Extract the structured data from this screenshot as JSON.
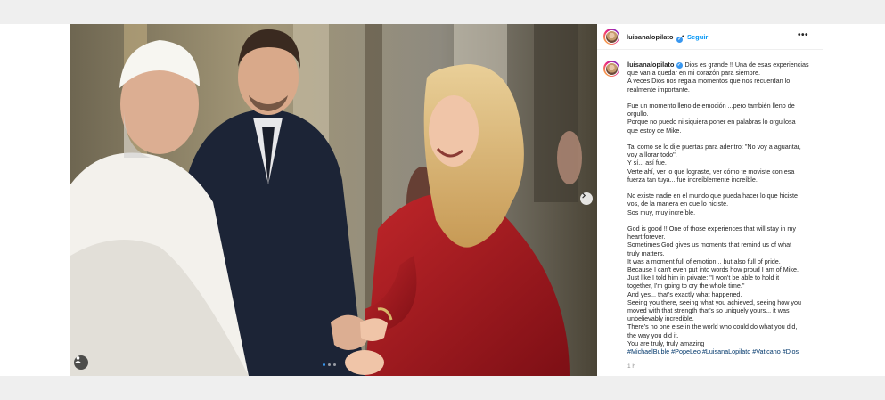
{
  "post": {
    "username": "luisanalopilato",
    "follow_label": "Seguir",
    "more_label": "•••",
    "separator": "•",
    "verified_mark": "✓",
    "time": "1 h"
  },
  "caption": {
    "paragraphs": [
      [
        "Dios es grande !! Una de esas experiencias",
        "que van a quedar en mi corazón para siempre.",
        "A veces Dios nos regala momentos que nos recuerdan lo",
        "realmente importante."
      ],
      [
        "Fue un momento lleno de emoción ...pero también lleno de",
        "orgullo.",
        "Porque no puedo ni siquiera poner en palabras lo orgullosa",
        "que estoy de Mike."
      ],
      [
        "Tal como se lo dije puertas para adentro: \"No voy a aguantar,",
        "voy a llorar todo\".",
        "Y sí... así fue.",
        "Verte ahí, ver lo que lograste, ver cómo te moviste con esa",
        "fuerza tan tuya... fue increíblemente increíble."
      ],
      [
        "No existe nadie en el mundo que pueda hacer lo que hiciste",
        "vos, de la manera en que lo hiciste.",
        "Sos muy, muy increíble."
      ],
      [
        "God is good !! One of those experiences that will stay in my",
        "heart forever.",
        "Sometimes God gives us moments that remind us of what",
        "truly matters.",
        "It was a moment full of emotion... but also full of pride.",
        "Because I can't even put into words how proud I am of Mike.",
        "Just like I told him in private: \"I won't be able to hold it",
        "together, I'm going to cry the whole time.\"",
        "And yes... that's exactly what happened.",
        "Seeing you there, seeing what you achieved, seeing how you",
        "moved with that strength that's so uniquely yours... it was",
        "unbelievably incredible.",
        "There's no one else in the world who could do what you did,",
        "the way you did it.",
        "You are truly, truly amazing"
      ]
    ],
    "hashtags": [
      "#MichaelBuble",
      "#PopeLeo",
      "#LuisanaLopilato",
      "#Vaticano",
      "#Dios"
    ]
  },
  "icons": {
    "avatar": "profile-avatar",
    "verified": "verified-badge-icon",
    "more": "more-options-icon",
    "tagged_user": "user-tag-icon",
    "next": "chevron-right-icon"
  },
  "colors": {
    "link": "#0095f6",
    "hashtag": "#00376b",
    "verified": "#3897f0"
  }
}
